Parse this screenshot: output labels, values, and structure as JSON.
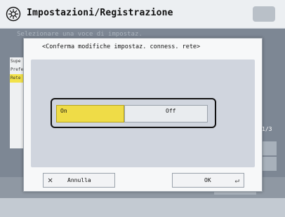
{
  "header": {
    "title": "Impostazioni/Registrazione",
    "gear_icon": "settings-gear-icon",
    "home_icon": "home-icon"
  },
  "background": {
    "subtitle": "Selezionare una voce di impostaz.",
    "list_items": [
      "Supe",
      "Prefe",
      "Rete"
    ],
    "page_indicator": "1/3",
    "colors": {
      "selected": "#f2e24a"
    }
  },
  "dialog": {
    "title": "<Conferma modifiche impostaz. conness. rete>",
    "on_label": "On",
    "off_label": "Off",
    "cancel_label": "Annulla",
    "ok_label": "OK",
    "selected_option": "On",
    "colors": {
      "accent": "#efdc47"
    }
  }
}
